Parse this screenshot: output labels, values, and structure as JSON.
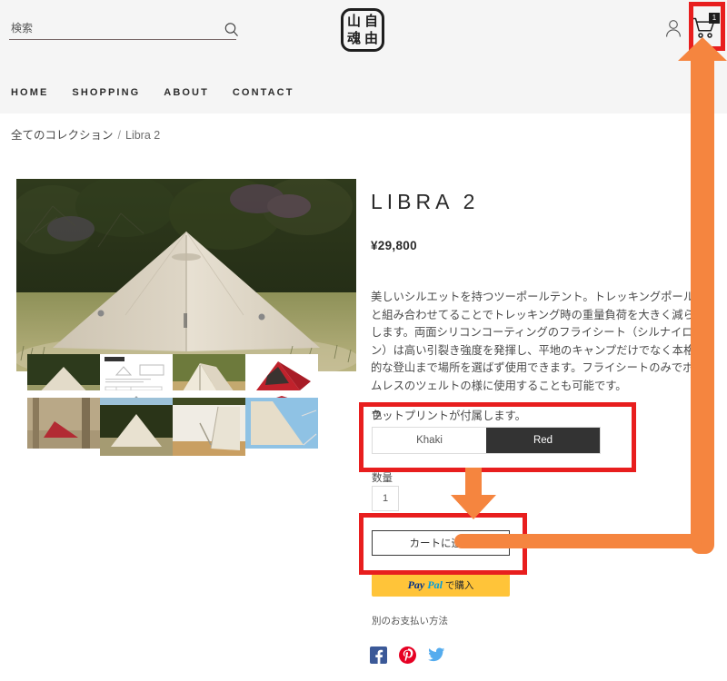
{
  "header": {
    "search": {
      "placeholder": "検索",
      "value": "",
      "icon": "search-icon"
    },
    "logo": {
      "chars": [
        "山",
        "自",
        "魂",
        "由"
      ]
    },
    "account_icon": "user-icon",
    "cart_icon": "cart-icon",
    "cart_count": "1"
  },
  "nav": {
    "items": [
      {
        "label": "HOME"
      },
      {
        "label": "SHOPPING"
      },
      {
        "label": "ABOUT"
      },
      {
        "label": "CONTACT"
      }
    ]
  },
  "breadcrumb": {
    "root": "全てのコレクション",
    "separator": "/",
    "current": "Libra 2"
  },
  "product": {
    "title": "LIBRA 2",
    "price": "¥29,800",
    "description_p1": "美しいシルエットを持つツーポールテント。トレッキングポールと組み合わせてることでトレッキング時の重量負荷を大きく減らします。両面シリコンコーティングのフライシート（シルナイロン）は高い引裂き強度を発揮し、平地のキャンプだけでなく本格的な登山まで場所を選ばず使用できます。フライシートのみでボトムレスのツェルトの様に使用することも可能です。",
    "description_p2": "フットプリントが付属します。",
    "color_label": "色",
    "color_options": [
      {
        "label": "Khaki",
        "selected": false
      },
      {
        "label": "Red",
        "selected": true
      }
    ],
    "quantity_label": "数量",
    "quantity_value": "1",
    "add_to_cart_label": "カートに追加",
    "paypal_pay": "Pay",
    "paypal_pal": "Pal",
    "paypal_suffix": "で購入",
    "other_payment_label": "別のお支払い方法"
  },
  "social": [
    {
      "name": "facebook-icon",
      "color": "#3b5998"
    },
    {
      "name": "pinterest-icon",
      "color": "#e60023"
    },
    {
      "name": "twitter-icon",
      "color": "#55acee"
    }
  ],
  "annotations": {
    "highlight_color": "#e81e1e",
    "arrow_color": "#f5853f",
    "targets": [
      "cart-button",
      "color-variant-selector",
      "add-to-cart-button"
    ]
  }
}
